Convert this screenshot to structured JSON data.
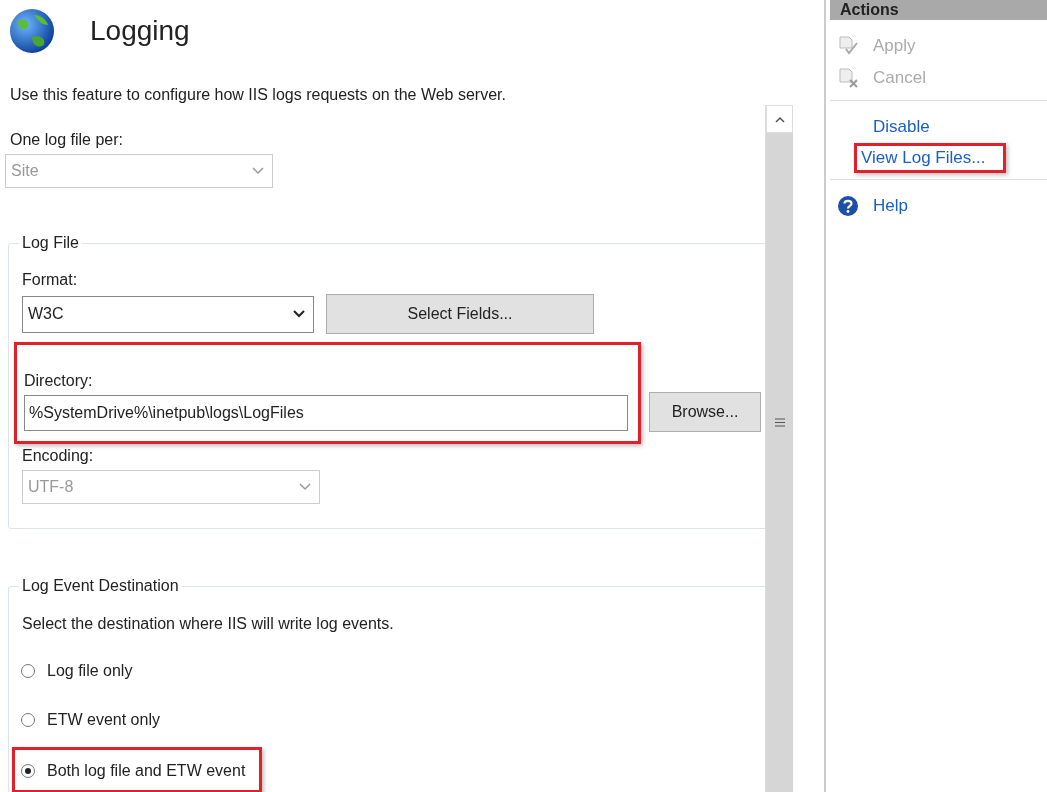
{
  "header": {
    "title": "Logging"
  },
  "description": "Use this feature to configure how IIS logs requests on the Web server.",
  "log_file_per": {
    "label": "One log file per:",
    "value": "Site",
    "disabled": true
  },
  "log_file": {
    "title": "Log File",
    "format": {
      "label": "Format:",
      "value": "W3C",
      "disabled": false
    },
    "select_fields_button": "Select Fields...",
    "directory": {
      "label": "Directory:",
      "value": "%SystemDrive%\\inetpub\\logs\\LogFiles",
      "highlighted": true
    },
    "browse_button": "Browse...",
    "encoding": {
      "label": "Encoding:",
      "value": "UTF-8",
      "disabled": true
    }
  },
  "log_event_destination": {
    "title": "Log Event Destination",
    "description": "Select the destination where IIS will write log events.",
    "options": [
      {
        "label": "Log file only",
        "selected": false,
        "highlighted": false
      },
      {
        "label": "ETW event only",
        "selected": false,
        "highlighted": false
      },
      {
        "label": "Both log file and ETW event",
        "selected": true,
        "highlighted": true
      }
    ]
  },
  "actions": {
    "title": "Actions",
    "groups": [
      [
        {
          "label": "Apply",
          "kind": "apply",
          "disabled": true,
          "highlighted": false
        },
        {
          "label": "Cancel",
          "kind": "cancel",
          "disabled": true,
          "highlighted": false
        }
      ],
      [
        {
          "label": "Disable",
          "kind": "link",
          "disabled": false,
          "highlighted": false
        },
        {
          "label": "View Log Files...",
          "kind": "link",
          "disabled": false,
          "highlighted": true
        }
      ],
      [
        {
          "label": "Help",
          "kind": "help",
          "disabled": false,
          "highlighted": false
        }
      ]
    ]
  }
}
